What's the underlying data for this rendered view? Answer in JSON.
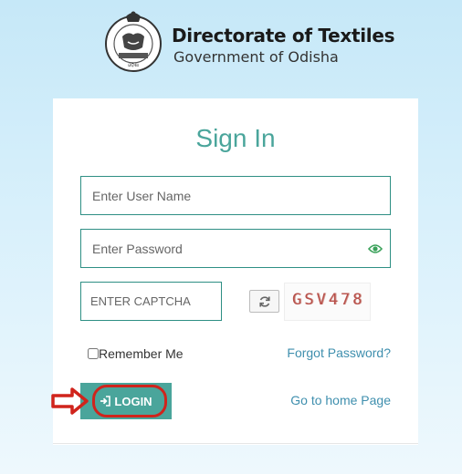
{
  "header": {
    "department": "Directorate of Textiles",
    "government": "Government of Odisha"
  },
  "form": {
    "title": "Sign In",
    "username_placeholder": "Enter User Name",
    "password_placeholder": "Enter Password",
    "captcha_placeholder": "ENTER CAPTCHA",
    "captcha_text": "GSV478",
    "remember_label": "Remember Me",
    "forgot_label": "Forgot Password?",
    "login_label": "LOGIN",
    "home_label": "Go to home Page"
  },
  "colors": {
    "accent": "#4aa59b",
    "field_border": "#2e8f84",
    "link": "#3f8fae",
    "annotation": "#d0241c"
  }
}
